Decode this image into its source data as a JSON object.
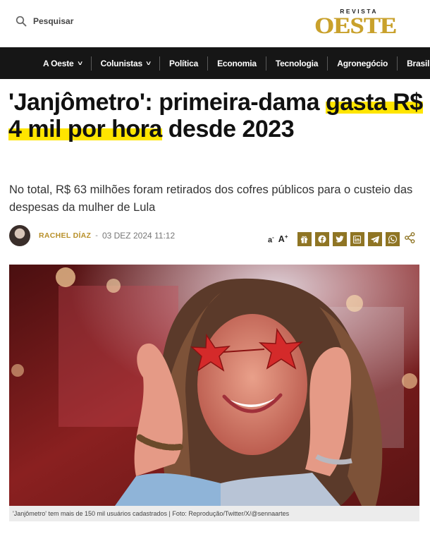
{
  "header": {
    "search_label": "Pesquisar",
    "logo_small": "REVISTA",
    "logo_big": "OESTE",
    "brand_color": "#c9a12c"
  },
  "nav": {
    "items": [
      {
        "label": "A Oeste",
        "has_dropdown": true
      },
      {
        "label": "Colunistas",
        "has_dropdown": true
      },
      {
        "label": "Política",
        "has_dropdown": false
      },
      {
        "label": "Economia",
        "has_dropdown": false
      },
      {
        "label": "Tecnologia",
        "has_dropdown": false
      },
      {
        "label": "Agronegócio",
        "has_dropdown": false
      },
      {
        "label": "Brasil",
        "has_dropdown": false
      }
    ]
  },
  "article": {
    "headline_part1": "'Janjômetro': primeira-dama ",
    "headline_highlight": "gasta R$ 4 mil por hora",
    "headline_part2": " desde 2023",
    "subtitle": "No total, R$ 63 milhões foram retirados dos cofres públicos para o custeio das despesas da mulher de Lula",
    "author": "RACHEL DÍAZ",
    "separator": "-",
    "date": "03 DEZ 2024 11:12",
    "font_decrease": "a",
    "font_increase": "A",
    "share_buttons": [
      "gift-icon",
      "facebook-icon",
      "twitter-icon",
      "linkedin-icon",
      "telegram-icon",
      "whatsapp-icon"
    ],
    "caption": "'Janjômetro' tem mais de 150 mil usuários cadastrados | Foto: Reprodução/Twitter/X/@sennaartes"
  },
  "colors": {
    "highlight": "#ffe500",
    "nav_bg": "#161616",
    "share_bg": "#8f7524"
  }
}
